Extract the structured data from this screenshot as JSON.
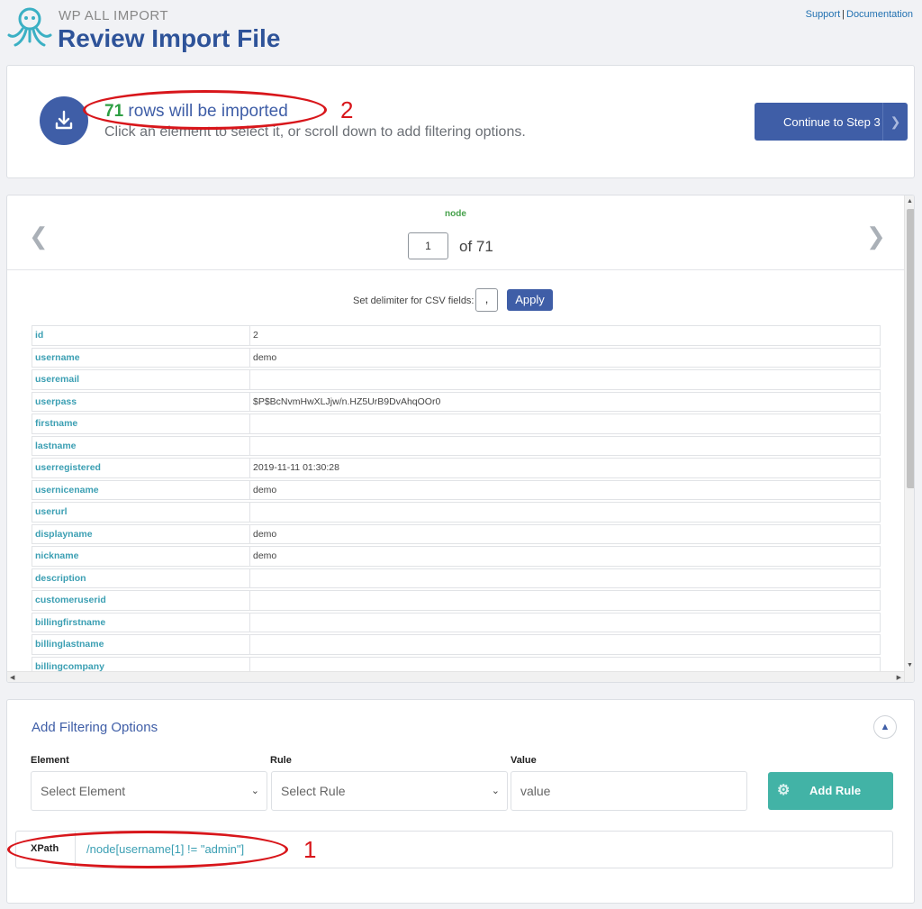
{
  "header": {
    "brand_small": "WP ALL IMPORT",
    "title": "Review Import File",
    "support_link": "Support",
    "separator": "|",
    "docs_link": "Documentation"
  },
  "summary": {
    "row_count": "71",
    "rows_text": "rows will be imported",
    "instruction": "Click an element to select it, or scroll down to add filtering options.",
    "continue_label": "Continue to Step 3"
  },
  "annotations": {
    "first": "1",
    "second": "2"
  },
  "preview": {
    "node_label": "node",
    "page_value": "1",
    "of_text": "of 71",
    "delimiter_label": "Set delimiter for CSV fields:",
    "delimiter_value": ",",
    "apply_label": "Apply",
    "rows": [
      {
        "key": "id",
        "value": "2"
      },
      {
        "key": "username",
        "value": "demo"
      },
      {
        "key": "useremail",
        "value": ""
      },
      {
        "key": "userpass",
        "value": "$P$BcNvmHwXLJjw/n.HZ5UrB9DvAhqOOr0"
      },
      {
        "key": "firstname",
        "value": ""
      },
      {
        "key": "lastname",
        "value": ""
      },
      {
        "key": "userregistered",
        "value": "2019-11-11 01:30:28"
      },
      {
        "key": "usernicename",
        "value": "demo"
      },
      {
        "key": "userurl",
        "value": ""
      },
      {
        "key": "displayname",
        "value": "demo"
      },
      {
        "key": "nickname",
        "value": "demo"
      },
      {
        "key": "description",
        "value": ""
      },
      {
        "key": "customeruserid",
        "value": ""
      },
      {
        "key": "billingfirstname",
        "value": ""
      },
      {
        "key": "billinglastname",
        "value": ""
      },
      {
        "key": "billingcompany",
        "value": ""
      }
    ]
  },
  "filtering": {
    "title": "Add Filtering Options",
    "element_label": "Element",
    "element_selected": "Select Element",
    "rule_label": "Rule",
    "rule_selected": "Select Rule",
    "value_label": "Value",
    "value_placeholder": "value",
    "add_rule_label": "Add Rule",
    "xpath_label": "XPath",
    "xpath_value": "/node[username[1] != \"admin\"]"
  },
  "colors": {
    "brand_blue": "#3f5ea7",
    "accent_teal": "#42b3a6",
    "count_green": "#2d9f43",
    "annotation_red": "#d8161b"
  }
}
